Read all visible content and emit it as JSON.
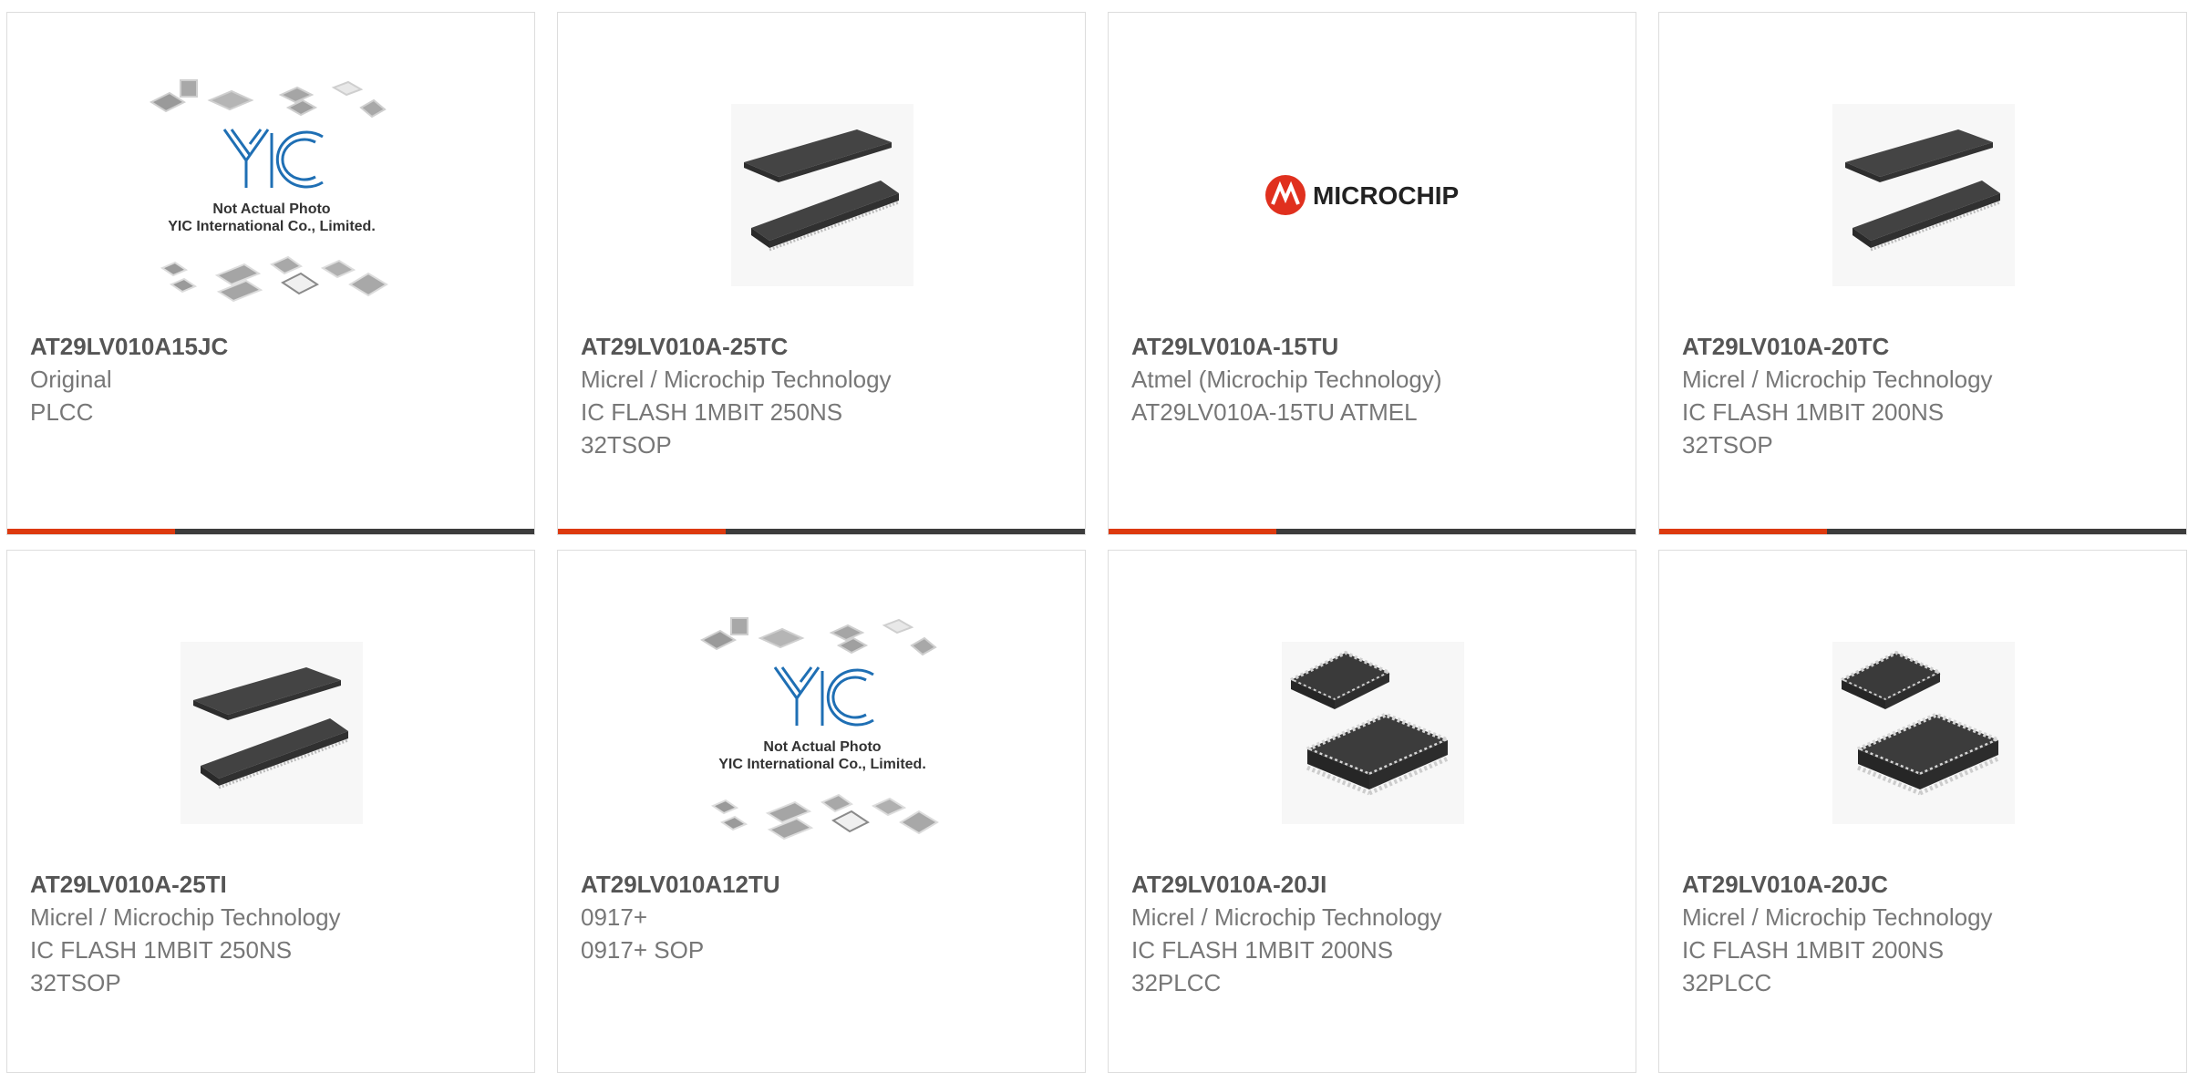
{
  "accent_color": "#dd3a0f",
  "bar_color": "#3c3c3c",
  "placeholder": {
    "line1": "Not Actual Photo",
    "line2": "YIC International Co., Limited.",
    "logo": "YIC"
  },
  "brand_logo_text": "MICROCHIP",
  "products": [
    {
      "title": "AT29LV010A15JC",
      "line1": "Original",
      "line2": "PLCC",
      "line3": "",
      "image": "yic-placeholder-photo"
    },
    {
      "title": "AT29LV010A-25TC",
      "line1": "Micrel / Microchip Technology",
      "line2": "IC FLASH 1MBIT 250NS",
      "line3": "32TSOP",
      "image": "tsop-chip-photo"
    },
    {
      "title": "AT29LV010A-15TU",
      "line1": "Atmel (Microchip Technology)",
      "line2": "AT29LV010A-15TU ATMEL",
      "line3": "",
      "image": "microchip-logo"
    },
    {
      "title": "AT29LV010A-20TC",
      "line1": "Micrel / Microchip Technology",
      "line2": "IC FLASH 1MBIT 200NS",
      "line3": "32TSOP",
      "image": "tsop-chip-photo"
    },
    {
      "title": "AT29LV010A-25TI",
      "line1": "Micrel / Microchip Technology",
      "line2": "IC FLASH 1MBIT 250NS",
      "line3": "32TSOP",
      "image": "tsop-chip-photo"
    },
    {
      "title": "AT29LV010A12TU",
      "line1": "0917+",
      "line2": "0917+ SOP",
      "line3": "",
      "image": "yic-placeholder-photo"
    },
    {
      "title": "AT29LV010A-20JI",
      "line1": "Micrel / Microchip Technology",
      "line2": "IC FLASH 1MBIT 200NS",
      "line3": "32PLCC",
      "image": "plcc-chip-photo"
    },
    {
      "title": "AT29LV010A-20JC",
      "line1": "Micrel / Microchip Technology",
      "line2": "IC FLASH 1MBIT 200NS",
      "line3": "32PLCC",
      "image": "plcc-chip-photo"
    }
  ]
}
